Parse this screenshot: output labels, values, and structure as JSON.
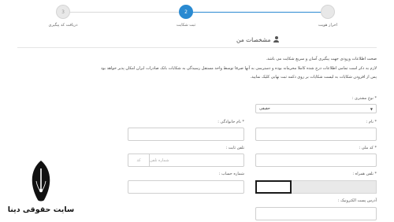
{
  "stepper": {
    "steps": [
      {
        "number": "3",
        "label": "دریافت کد پیگیری"
      },
      {
        "number": "2",
        "label": "ثبت شکایت"
      },
      {
        "number": "",
        "label": "احراز هویت"
      }
    ]
  },
  "section": {
    "title": "مشخصات من"
  },
  "notes": {
    "line1": "صحت اطلاعات ورودی جهت پیگیری آسان و سریع شکایت می باشد.",
    "line2": "لازم به ذکر است تمامی اطلاعات درج شده کاملا محرمانه بوده و دسترسی به آنها صرفا توسط واحد مستقل رسیدگی به شکایات بانک صادرات ایران امکان پذیر خواهد بود",
    "line3": "پس از افزودن شکایات به لیست شکایات بر روی دکمه ثبت نهایی کلیک نمایید."
  },
  "form": {
    "customer_type": {
      "label": "* نوع مشتری :",
      "value": "حقیقی"
    },
    "first_name": {
      "label": "* نام :"
    },
    "last_name": {
      "label": "* نام خانوادگی :"
    },
    "national_code": {
      "label": "* کد ملی :"
    },
    "landline": {
      "label": "تلفن ثابت :",
      "area_placeholder": "کد",
      "number_placeholder": "شماره تلفن"
    },
    "mobile": {
      "label": "* تلفن همراه :"
    },
    "account_number": {
      "label": "شماره حساب :"
    },
    "email": {
      "label": "آدرس پست الکترونیک :"
    }
  },
  "logo": {
    "text": "سایت حقوقی دینا"
  }
}
